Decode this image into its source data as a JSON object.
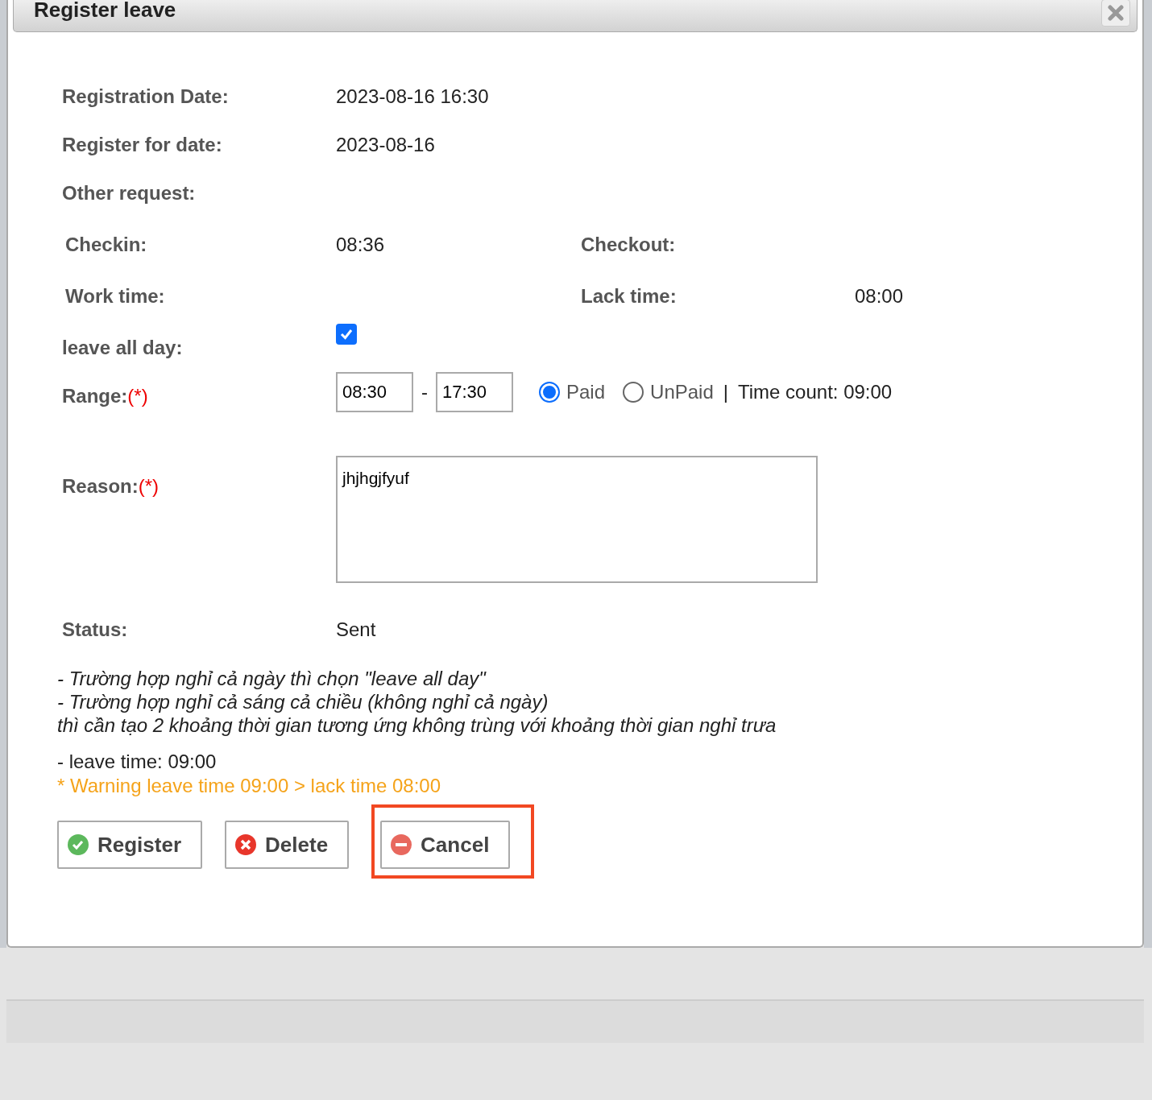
{
  "dialog": {
    "title": "Register leave"
  },
  "info_rows": [
    {
      "label": "Registration Date:",
      "value": "2023-08-16 16:30"
    },
    {
      "label": "Register for date:",
      "value": "2023-08-16"
    },
    {
      "label": "Other request:"
    }
  ],
  "time_rows": [
    [
      {
        "label": "Checkin:",
        "value": "08:36"
      },
      {
        "label": "Checkout:"
      }
    ],
    [
      {
        "label": "Work time:"
      },
      {
        "label": "Lack time:",
        "value": "08:00"
      }
    ]
  ],
  "leave_all_day": {
    "label": "leave all day:",
    "checked": true
  },
  "range": {
    "label": "Range:",
    "required_mark": "(*)",
    "from": "08:30",
    "separator": "-",
    "to": "17:30",
    "pay_options": [
      {
        "label": "Paid",
        "selected": true
      },
      {
        "label": "UnPaid",
        "selected": false
      }
    ],
    "divider": "|",
    "time_count": "Time count: 09:00"
  },
  "reason": {
    "label": "Reason:",
    "required_mark": "(*)",
    "value": "jhjhgjfyuf"
  },
  "status": {
    "label": "Status:",
    "value": "Sent"
  },
  "notes": [
    "- Trường hợp nghỉ cả ngày thì chọn \"leave all day\"",
    "- Trường hợp nghỉ cả sáng cả chiều (không nghỉ cả ngày)",
    "thì cần tạo 2 khoảng thời gian tương ứng không trùng với khoảng thời gian nghỉ trưa"
  ],
  "leave_time": "- leave time: 09:00",
  "warning": "* Warning leave time 09:00 > lack time 08:00",
  "buttons": [
    {
      "label": "Register",
      "kind": "confirm",
      "highlighted": false
    },
    {
      "label": "Delete",
      "kind": "delete",
      "highlighted": false
    },
    {
      "label": "Cancel",
      "kind": "cancel",
      "highlighted": true
    }
  ]
}
